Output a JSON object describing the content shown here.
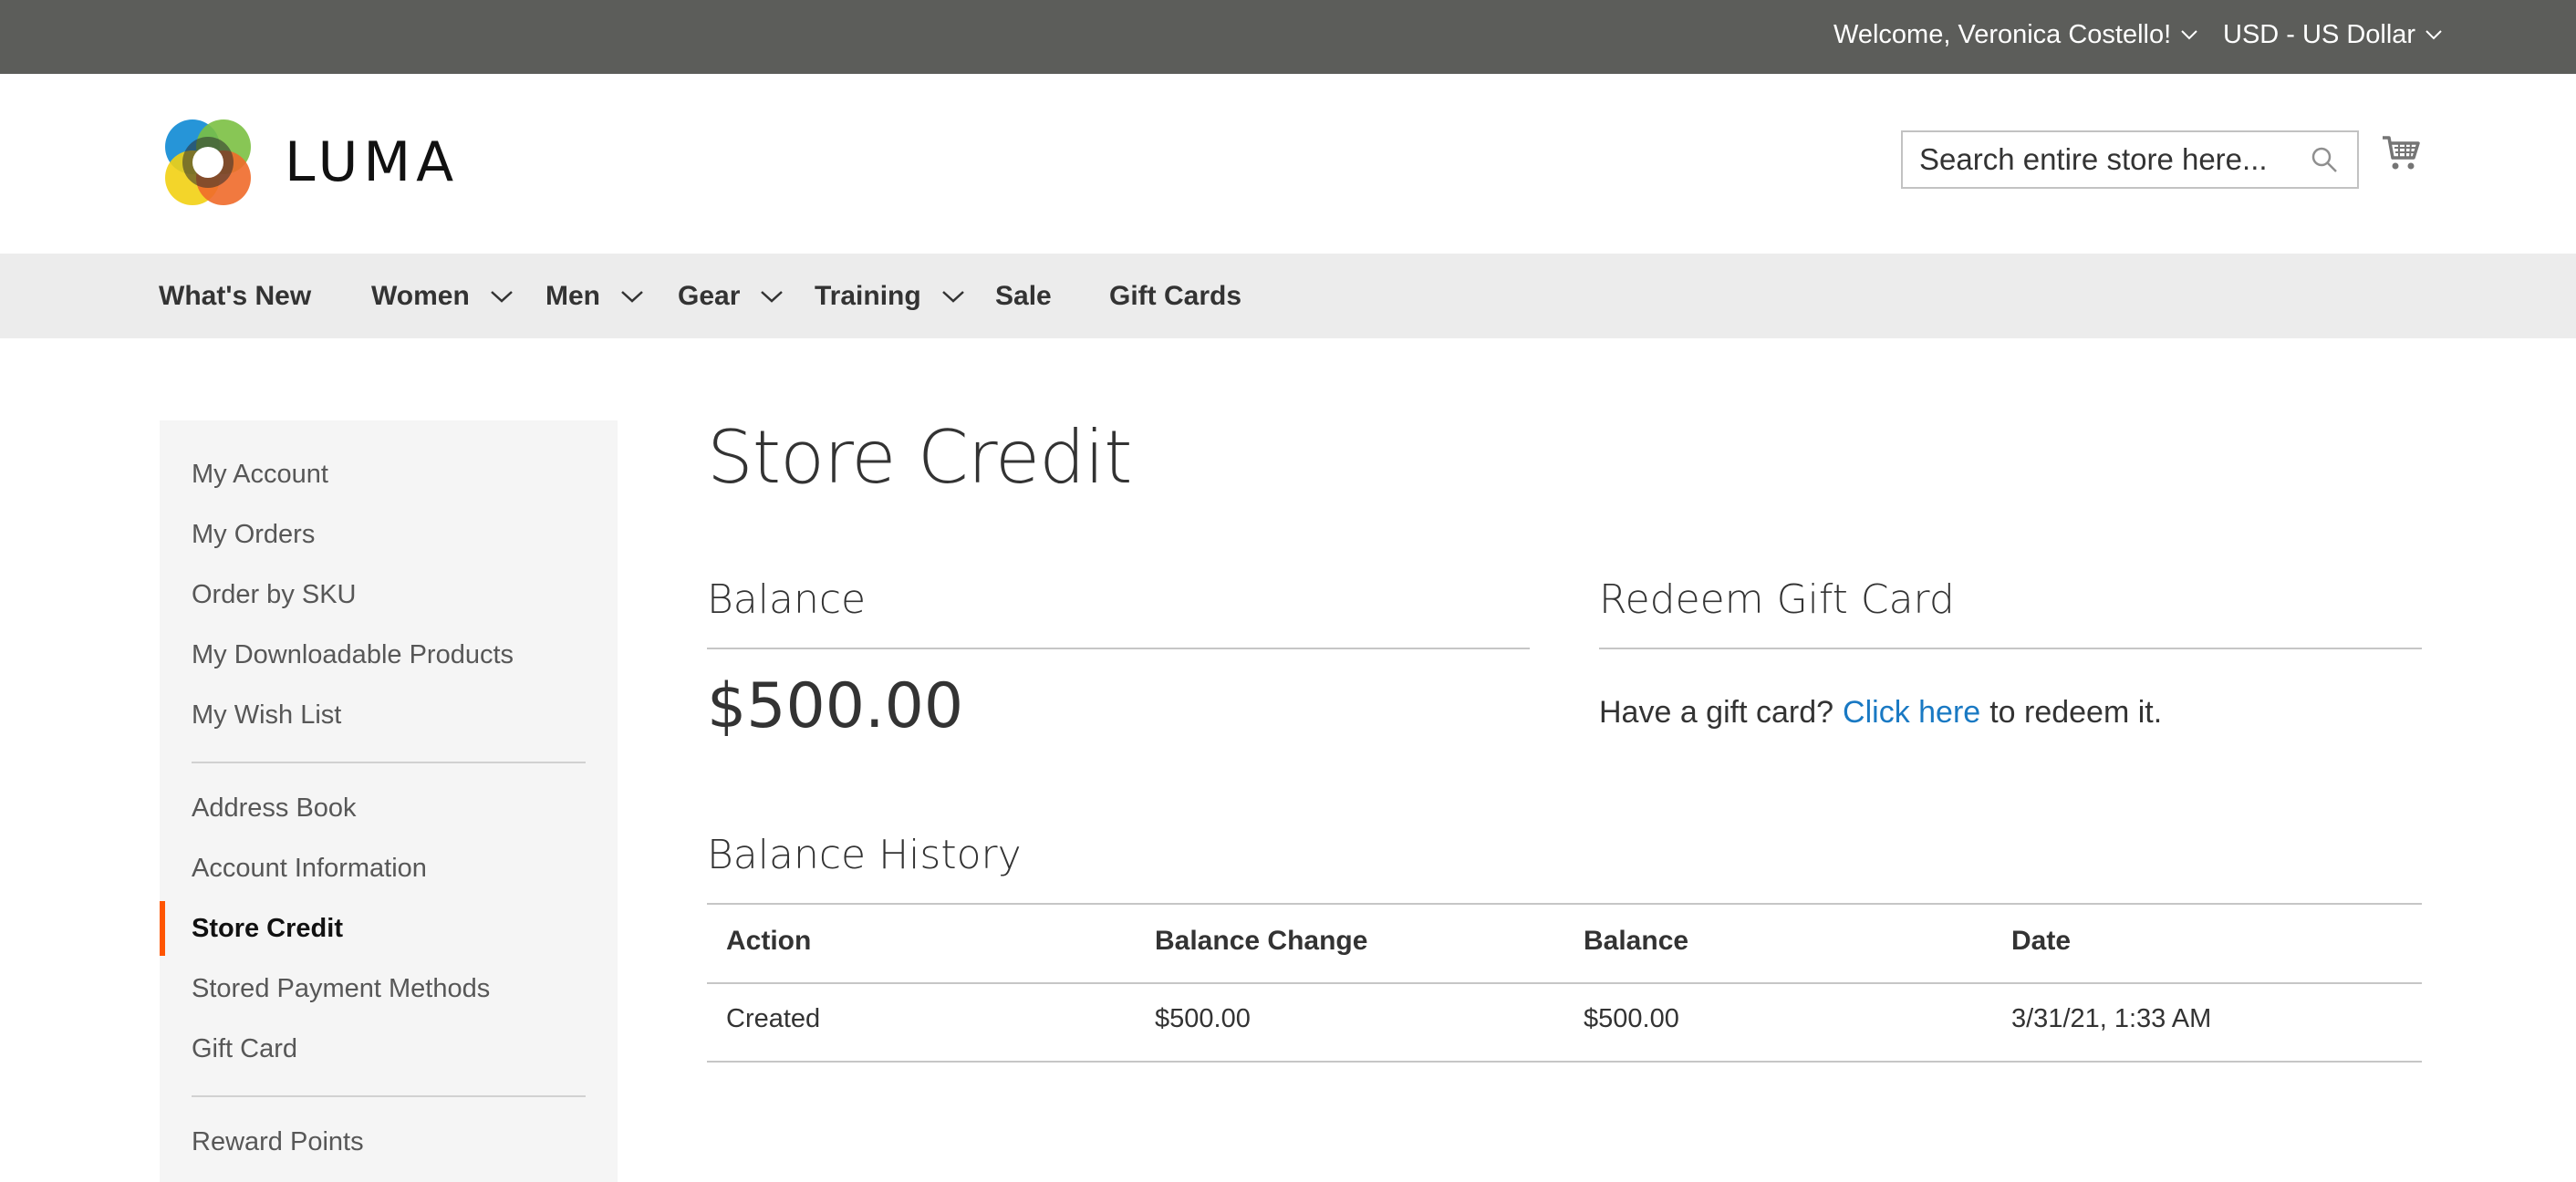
{
  "topbar": {
    "welcome": "Welcome, Veronica Costello!",
    "currency": "USD - US Dollar",
    "background": "#5c5d5a"
  },
  "header": {
    "logo_text": "LUMA",
    "search_placeholder": "Search entire store here...",
    "icons": [
      "search-icon",
      "cart-icon",
      "chevron-down-icon"
    ]
  },
  "nav": {
    "items": [
      {
        "label": "What's New",
        "has_dropdown": false
      },
      {
        "label": "Women",
        "has_dropdown": true
      },
      {
        "label": "Men",
        "has_dropdown": true
      },
      {
        "label": "Gear",
        "has_dropdown": true
      },
      {
        "label": "Training",
        "has_dropdown": true
      },
      {
        "label": "Sale",
        "has_dropdown": false
      },
      {
        "label": "Gift Cards",
        "has_dropdown": false
      }
    ]
  },
  "sidebar": {
    "items": [
      {
        "label": "My Account"
      },
      {
        "label": "My Orders"
      },
      {
        "label": "Order by SKU"
      },
      {
        "label": "My Downloadable Products"
      },
      {
        "label": "My Wish List"
      },
      {
        "label": "Address Book"
      },
      {
        "label": "Account Information"
      },
      {
        "label": "Store Credit",
        "active": true
      },
      {
        "label": "Stored Payment Methods"
      },
      {
        "label": "Gift Card"
      },
      {
        "label": "Reward Points"
      }
    ],
    "active_color": "#ff5501"
  },
  "main": {
    "title": "Store Credit",
    "balance": {
      "title": "Balance",
      "amount": "$500.00"
    },
    "redeem": {
      "title": "Redeem Gift Card",
      "text_before": "Have a gift card?",
      "link": "Click here",
      "text_after": "to redeem it.",
      "link_color": "#1979c3"
    },
    "history": {
      "title": "Balance History",
      "columns": [
        "Action",
        "Balance Change",
        "Balance",
        "Date"
      ],
      "rows": [
        [
          "Created",
          "$500.00",
          "$500.00",
          "3/31/21, 1:33 AM"
        ]
      ]
    }
  }
}
